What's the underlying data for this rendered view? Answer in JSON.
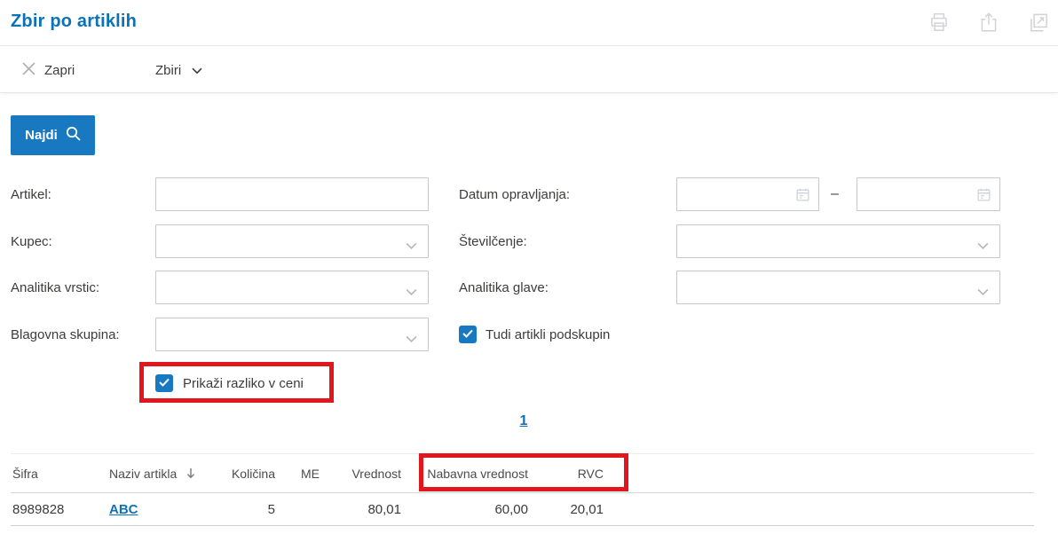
{
  "header": {
    "title": "Zbir po artiklih",
    "icons": [
      "print-icon",
      "export-icon",
      "open-new-window-icon"
    ]
  },
  "toolbar": {
    "close_label": "Zapri",
    "views_label": "Zbiri"
  },
  "search": {
    "find_label": "Najdi"
  },
  "filters": {
    "artikel": {
      "label": "Artikel:",
      "value": ""
    },
    "kupec": {
      "label": "Kupec:",
      "value": ""
    },
    "analitika_vrstic": {
      "label": "Analitika vrstic:",
      "value": ""
    },
    "blagovna_skupina": {
      "label": "Blagovna skupina:",
      "value": ""
    },
    "datum_opravljanja": {
      "label": "Datum opravljanja:",
      "from": "",
      "to": "",
      "separator": "–"
    },
    "stevilcenje": {
      "label": "Številčenje:",
      "value": ""
    },
    "analitika_glave": {
      "label": "Analitika glave:",
      "value": ""
    },
    "tudi_artikli_podskupin": {
      "label": "Tudi artikli podskupin",
      "checked": true
    },
    "prikazi_razliko_v_ceni": {
      "label": "Prikaži razliko v ceni",
      "checked": true
    }
  },
  "pagination": {
    "current_page": "1"
  },
  "table": {
    "headers": [
      "Šifra",
      "Naziv artikla",
      "Količina",
      "ME",
      "Vrednost",
      "Nabavna vrednost",
      "RVC"
    ],
    "sorted_column": "Naziv artikla",
    "sort_icon": "arrow-down",
    "rows": [
      {
        "sifra": "8989828",
        "naziv_artikla": "ABC",
        "kolicina": "5",
        "me": "",
        "vrednost": "80,01",
        "nabavna_vrednost": "60,00",
        "rvc": "20,01"
      }
    ]
  },
  "colors": {
    "accent_blue": "#0c72b8",
    "button_blue": "#1879c0",
    "checkbox_blue": "#1779c1",
    "annotation_red": "#e0181e"
  }
}
